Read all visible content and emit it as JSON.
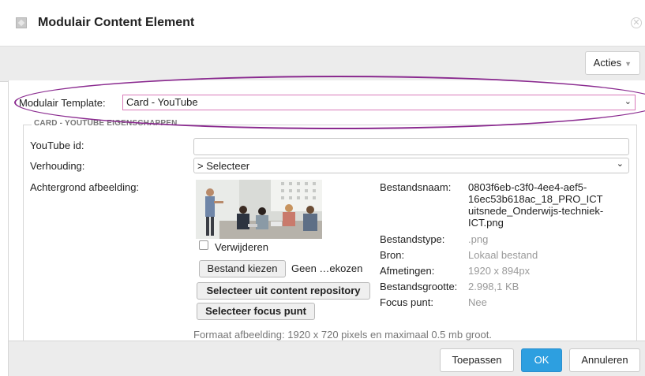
{
  "window": {
    "title": "Modulair Content Element"
  },
  "toolbar": {
    "acties_label": "Acties"
  },
  "template": {
    "label": "Modulair Template:",
    "value": "Card - YouTube"
  },
  "section": {
    "legend": "CARD - YOUTUBE EIGENSCHAPPEN"
  },
  "fields": {
    "youtube_label": "YouTube id:",
    "youtube_value": "",
    "verhouding_label": "Verhouding:",
    "verhouding_value": "> Selecteer",
    "achtergrond_label": "Achtergrond afbeelding:",
    "verwijderen_label": "Verwijderen",
    "bestand_kiezen_label": "Bestand kiezen",
    "geen_label": "Geen …ekozen",
    "repo_button": "Selecteer uit content repository",
    "focus_button": "Selecteer focus punt",
    "format_hint": "Formaat afbeelding: 1920 x 720 pixels en maximaal 0.5 mb groot."
  },
  "file_info": {
    "bestandsnaam_label": "Bestandsnaam:",
    "bestandsnaam_lines": [
      "0803f6eb-c3f0-4ee4-aef5-",
      "16ec53b618ac_18_PRO_ICT",
      "uitsnede_Onderwijs-techniek-",
      "ICT.png"
    ],
    "bestandstype_label": "Bestandstype:",
    "bestandstype_value": ".png",
    "bron_label": "Bron:",
    "bron_value": "Lokaal bestand",
    "afmetingen_label": "Afmetingen:",
    "afmetingen_value": "1920 x 894px",
    "grootte_label": "Bestandsgrootte:",
    "grootte_value": "2.998,1 KB",
    "focus_label": "Focus punt:",
    "focus_value": "Nee"
  },
  "footer": {
    "toepassen_label": "Toepassen",
    "ok_label": "OK",
    "annuleren_label": "Annuleren"
  },
  "icons": {
    "window": "module-icon",
    "close": "close-icon",
    "chevron": "chevron-down-icon"
  },
  "colors": {
    "ok_button": "#2d9fe0",
    "annotation_oval": "#8a2a8f",
    "highlight_border": "#d97ab9"
  }
}
